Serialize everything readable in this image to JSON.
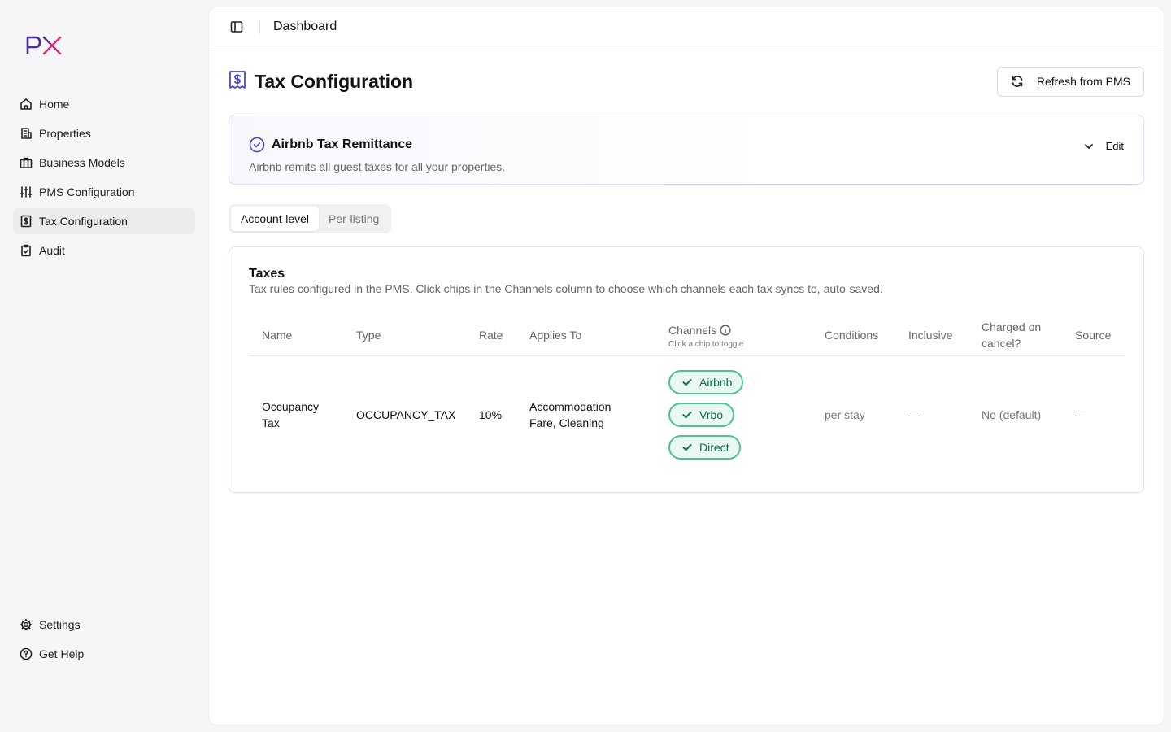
{
  "sidebar": {
    "logo_text": "PX",
    "items": [
      {
        "label": "Home",
        "icon": "home-icon"
      },
      {
        "label": "Properties",
        "icon": "building-icon"
      },
      {
        "label": "Business Models",
        "icon": "briefcase-icon"
      },
      {
        "label": "PMS Configuration",
        "icon": "sliders-icon"
      },
      {
        "label": "Tax Configuration",
        "icon": "receipt-dollar-icon",
        "active": true
      },
      {
        "label": "Audit",
        "icon": "clipboard-check-icon"
      }
    ],
    "bottom_items": [
      {
        "label": "Settings",
        "icon": "gear-icon"
      },
      {
        "label": "Get Help",
        "icon": "help-circle-icon"
      }
    ]
  },
  "topbar": {
    "breadcrumb": "Dashboard"
  },
  "page": {
    "title": "Tax Configuration",
    "refresh_label": "Refresh from PMS"
  },
  "remittance": {
    "title": "Airbnb Tax Remittance",
    "description": "Airbnb remits all guest taxes for all your properties.",
    "edit_label": "Edit"
  },
  "tabs": [
    {
      "label": "Account-level",
      "active": true
    },
    {
      "label": "Per-listing",
      "active": false
    }
  ],
  "taxes": {
    "title": "Taxes",
    "description": "Tax rules configured in the PMS. Click chips in the Channels column to choose which channels each tax syncs to, auto-saved.",
    "columns": {
      "name": "Name",
      "type": "Type",
      "rate": "Rate",
      "applies_to": "Applies To",
      "channels": "Channels",
      "channels_hint": "Click a chip to toggle",
      "conditions": "Conditions",
      "inclusive": "Inclusive",
      "charged_on_cancel_1": "Charged on",
      "charged_on_cancel_2": "cancel?",
      "source": "Source"
    },
    "rows": [
      {
        "name_1": "Occupancy",
        "name_2": "Tax",
        "type": "OCCUPANCY_TAX",
        "rate": "10%",
        "applies_to_1": "Accommodation",
        "applies_to_2": "Fare, Cleaning",
        "channels": [
          "Airbnb",
          "Vrbo",
          "Direct"
        ],
        "conditions": "per stay",
        "inclusive": "—",
        "charged_on_cancel": "No (default)",
        "source": "—"
      }
    ]
  },
  "colors": {
    "accent": "#4b48c7",
    "chip_border": "#4fbf97",
    "chip_bg": "#e9f8f1",
    "chip_text": "#136a4c"
  }
}
